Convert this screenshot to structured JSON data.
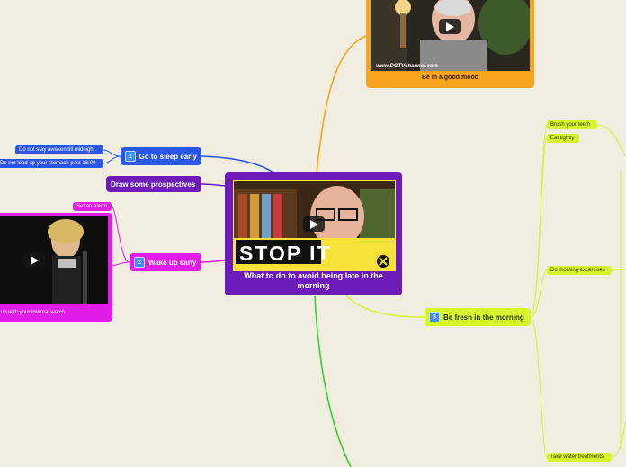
{
  "central": {
    "title": "What to do to avoid being late in the morning",
    "video_text": "STOP IT"
  },
  "mood": {
    "label": "Be in a good mood",
    "video_url_text": "www.DGTVchannel.com"
  },
  "sleep": {
    "number": "1",
    "label": "Go to sleep early",
    "children": [
      "Do not stay awaken till midnight",
      "Do not load up your stomach past 18:00"
    ]
  },
  "prospectives": {
    "label": "Draw some prospectives"
  },
  "wake": {
    "number": "2",
    "label": "Wake up early",
    "alarm": "Set an alarm",
    "watch_caption": "up with your internal watch"
  },
  "fresh": {
    "number": "3",
    "label": "Be fresh in the morning",
    "children": [
      "Brush your teeth",
      "Eat tightly",
      "Do morning excercises",
      "Take water treatments"
    ]
  },
  "colors": {
    "background": "#f1ede0",
    "central": "#6d1bb8",
    "sleep": "#2a56e8",
    "wake": "#e21ce9",
    "fresh": "#d6f52c",
    "mood": "#f9a41e",
    "green_branch": "#2fd42f"
  }
}
